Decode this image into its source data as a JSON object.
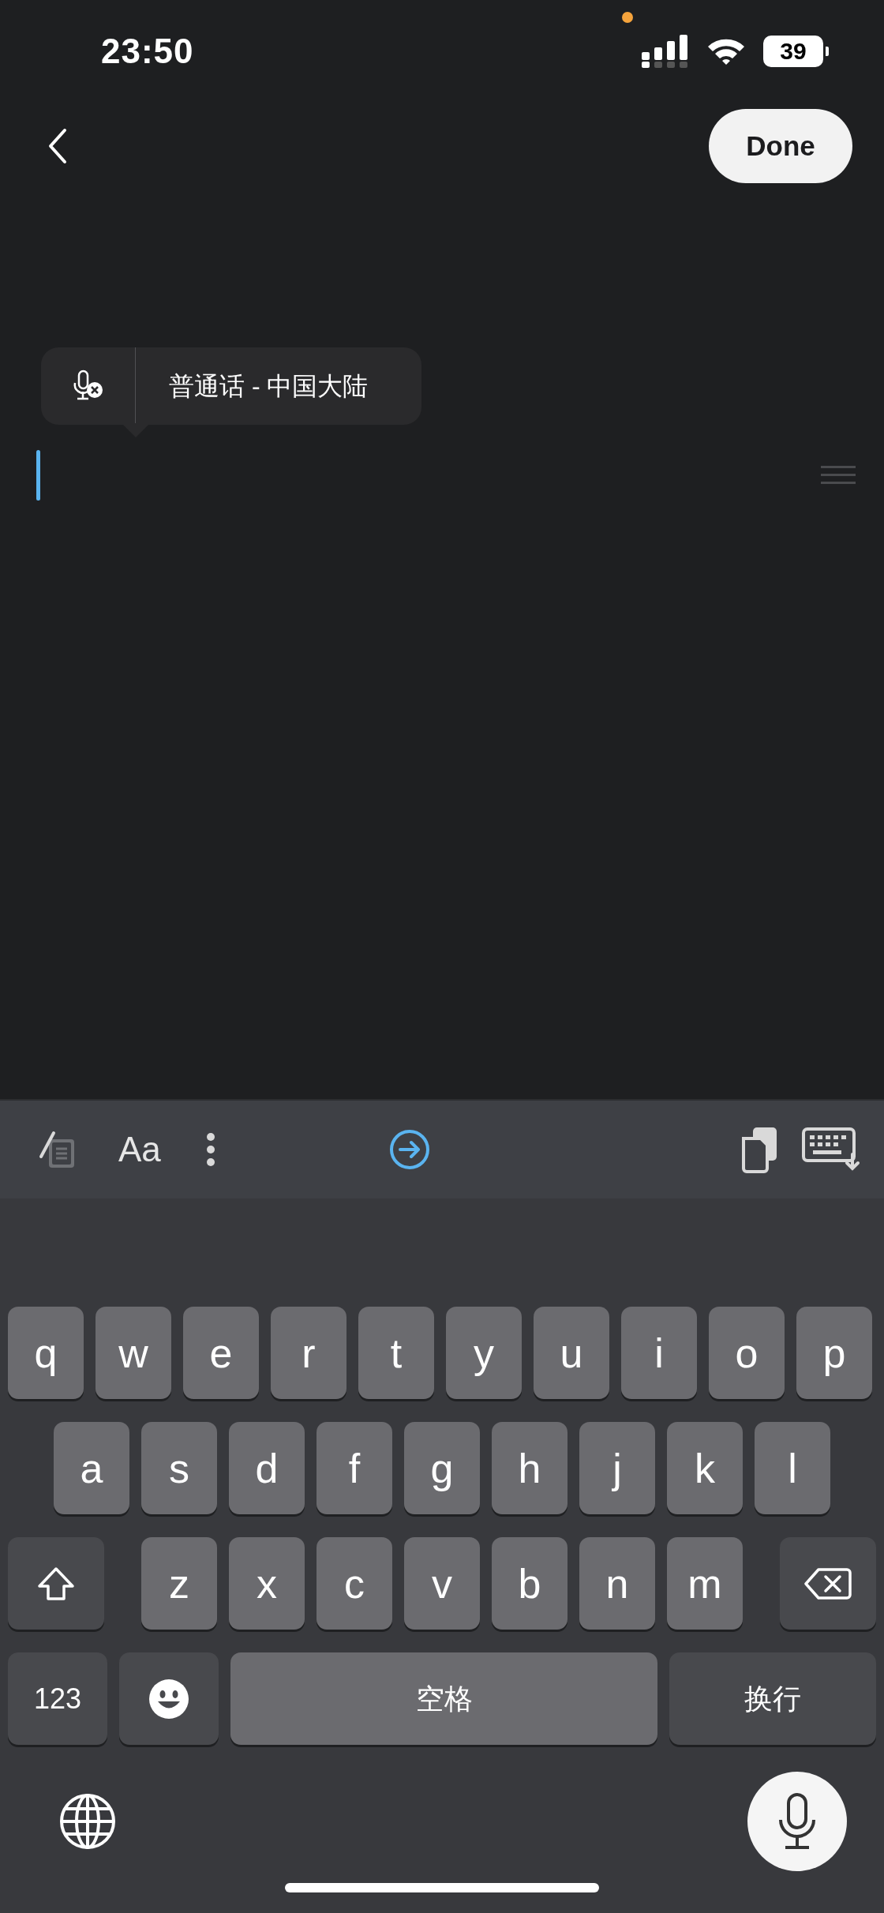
{
  "status_bar": {
    "time": "23:50",
    "battery": "39"
  },
  "nav": {
    "done": "Done"
  },
  "dictation_popup": {
    "language": "普通话 - 中国大陆"
  },
  "toolbar": {
    "format_label": "Aa"
  },
  "keyboard": {
    "letter_rows": [
      [
        {
          "kind": "letter",
          "label": "q"
        },
        {
          "kind": "letter",
          "label": "w"
        },
        {
          "kind": "letter",
          "label": "e"
        },
        {
          "kind": "letter",
          "label": "r"
        },
        {
          "kind": "letter",
          "label": "t"
        },
        {
          "kind": "letter",
          "label": "y"
        },
        {
          "kind": "letter",
          "label": "u"
        },
        {
          "kind": "letter",
          "label": "i"
        },
        {
          "kind": "letter",
          "label": "o"
        },
        {
          "kind": "letter",
          "label": "p"
        }
      ],
      [
        {
          "kind": "letter",
          "label": "a"
        },
        {
          "kind": "letter",
          "label": "s"
        },
        {
          "kind": "letter",
          "label": "d"
        },
        {
          "kind": "letter",
          "label": "f"
        },
        {
          "kind": "letter",
          "label": "g"
        },
        {
          "kind": "letter",
          "label": "h"
        },
        {
          "kind": "letter",
          "label": "j"
        },
        {
          "kind": "letter",
          "label": "k"
        },
        {
          "kind": "letter",
          "label": "l"
        }
      ],
      [
        {
          "kind": "shift"
        },
        {
          "kind": "letter",
          "label": "z"
        },
        {
          "kind": "letter",
          "label": "x"
        },
        {
          "kind": "letter",
          "label": "c"
        },
        {
          "kind": "letter",
          "label": "v"
        },
        {
          "kind": "letter",
          "label": "b"
        },
        {
          "kind": "letter",
          "label": "n"
        },
        {
          "kind": "letter",
          "label": "m"
        },
        {
          "kind": "delete"
        }
      ]
    ],
    "bottom_keys": {
      "mode": "123",
      "space": "空格",
      "return": "换行"
    }
  }
}
